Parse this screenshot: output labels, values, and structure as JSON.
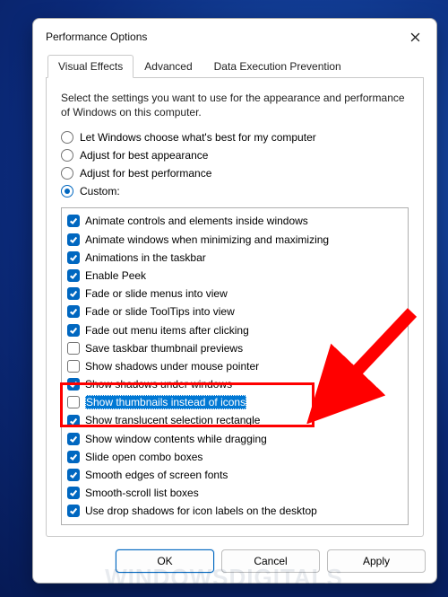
{
  "window": {
    "title": "Performance Options"
  },
  "tabs": [
    {
      "label": "Visual Effects",
      "active": true
    },
    {
      "label": "Advanced",
      "active": false
    },
    {
      "label": "Data Execution Prevention",
      "active": false
    }
  ],
  "description": "Select the settings you want to use for the appearance and performance of Windows on this computer.",
  "radios": [
    {
      "label": "Let Windows choose what's best for my computer",
      "checked": false
    },
    {
      "label": "Adjust for best appearance",
      "checked": false
    },
    {
      "label": "Adjust for best performance",
      "checked": false
    },
    {
      "label": "Custom:",
      "checked": true
    }
  ],
  "checkboxes": [
    {
      "label": "Animate controls and elements inside windows",
      "checked": true,
      "selected": false
    },
    {
      "label": "Animate windows when minimizing and maximizing",
      "checked": true,
      "selected": false
    },
    {
      "label": "Animations in the taskbar",
      "checked": true,
      "selected": false
    },
    {
      "label": "Enable Peek",
      "checked": true,
      "selected": false
    },
    {
      "label": "Fade or slide menus into view",
      "checked": true,
      "selected": false
    },
    {
      "label": "Fade or slide ToolTips into view",
      "checked": true,
      "selected": false
    },
    {
      "label": "Fade out menu items after clicking",
      "checked": true,
      "selected": false
    },
    {
      "label": "Save taskbar thumbnail previews",
      "checked": false,
      "selected": false
    },
    {
      "label": "Show shadows under mouse pointer",
      "checked": false,
      "selected": false
    },
    {
      "label": "Show shadows under windows",
      "checked": true,
      "selected": false
    },
    {
      "label": "Show thumbnails instead of icons",
      "checked": false,
      "selected": true
    },
    {
      "label": "Show translucent selection rectangle",
      "checked": true,
      "selected": false
    },
    {
      "label": "Show window contents while dragging",
      "checked": true,
      "selected": false
    },
    {
      "label": "Slide open combo boxes",
      "checked": true,
      "selected": false
    },
    {
      "label": "Smooth edges of screen fonts",
      "checked": true,
      "selected": false
    },
    {
      "label": "Smooth-scroll list boxes",
      "checked": true,
      "selected": false
    },
    {
      "label": "Use drop shadows for icon labels on the desktop",
      "checked": true,
      "selected": false
    }
  ],
  "buttons": {
    "ok": "OK",
    "cancel": "Cancel",
    "apply": "Apply"
  },
  "annotation": {
    "highlight_index": 10,
    "arrow_color": "#ff0000"
  },
  "watermark": "WindowsDigitals"
}
